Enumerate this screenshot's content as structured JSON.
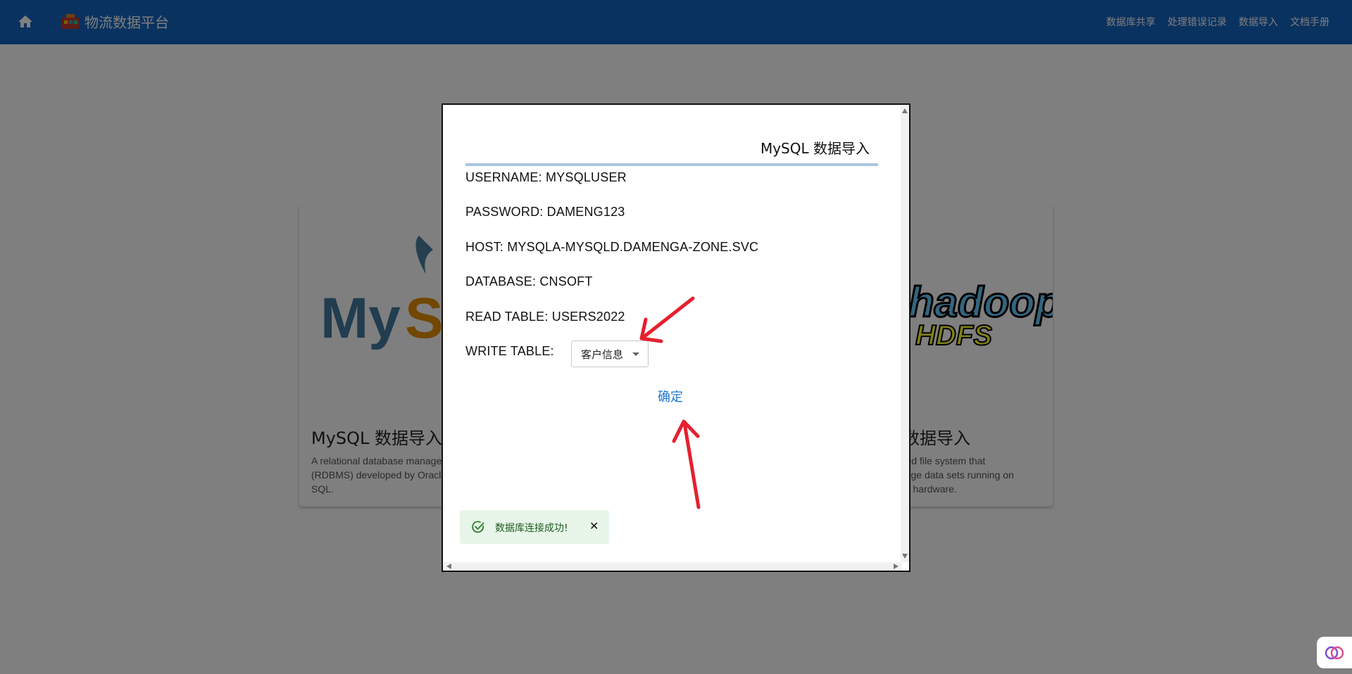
{
  "header": {
    "brand_name": "物流数据平台",
    "nav": [
      "数据库共享",
      "处理错误记录",
      "数据导入",
      "文档手册"
    ]
  },
  "cards": [
    {
      "title": "MySQL 数据导入",
      "logo_text": "MySQL",
      "description": "A relational database management system (RDBMS) developed by Oracle that is based on SQL."
    },
    {
      "title": "HDFS 数据导入",
      "logo_text": "hadoop HDFS",
      "description": "A distributed file system that handles large data sets running on commodity hardware."
    }
  ],
  "dialog": {
    "title": "MySQL 数据导入",
    "username": "USERNAME: MYSQLUSER",
    "password": "PASSWORD: DAMENG123",
    "host": "HOST: MYSQLA-MYSQLD.DAMENGA-ZONE.SVC",
    "database": "DATABASE: CNSOFT",
    "read_table": "READ TABLE: USERS2022",
    "write_table_label": "WRITE TABLE:",
    "write_table_value": "客户信息",
    "confirm_label": "确定"
  },
  "toast": {
    "message": "数据库连接成功!",
    "close_symbol": "✕"
  },
  "colors": {
    "header": "#1565c0",
    "accent": "#1976d2",
    "toast_bg": "#e8f5e9",
    "annotation_arrow": "#e5202f"
  },
  "icons": [
    "home-icon",
    "brand-logo-icon",
    "check-circle-icon",
    "close-icon",
    "chevron-down-icon",
    "brain-icon"
  ]
}
